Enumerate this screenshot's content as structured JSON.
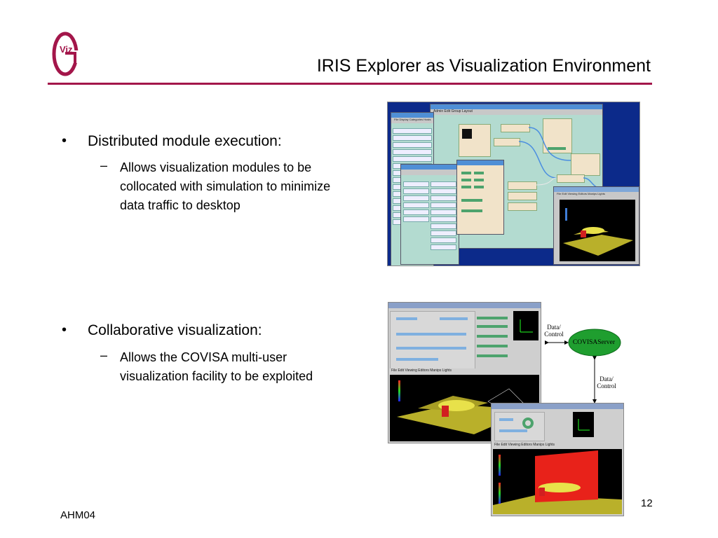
{
  "slide": {
    "title": "IRIS Explorer as Visualization Environment",
    "footer_left": "AHM04",
    "page_number": "12"
  },
  "logo": {
    "text": "Viz",
    "letter": "G",
    "color": "#a3164a"
  },
  "bullets": [
    {
      "marker": "•",
      "text": "Distributed module execution:",
      "sub": [
        {
          "marker": "–",
          "text": "Allows visualization modules to be collocated with simulation to minimize data traffic to desktop"
        }
      ]
    },
    {
      "marker": "•",
      "text": "Collaborative visualization:",
      "sub": [
        {
          "marker": "–",
          "text": "Allows the COVISA multi-user visualization facility to be exploited"
        }
      ]
    }
  ],
  "diagram": {
    "server_label": "COVISAServer",
    "upper_link_label": "Data/ Control",
    "lower_link_label": "Data/ Control",
    "server_color": "#1f9e2f"
  },
  "screenshot1": {
    "map_editor_title": "Map Editor on: cmpcu04.leeds.ac.uk",
    "map_editor_menu": "Admin   Edit   Group   Layout",
    "librarian_menu": "File   Display   Categories   Hosts",
    "render_menu": "File   Edit   Viewing   Editors   Manips   Lights"
  },
  "screenshot2": {
    "render_menu": "File   Edit   Viewing   Editors   Manips   Lights"
  },
  "screenshot3": {
    "render_menu": "File   Edit   Viewing   Editors   Manips   Lights"
  },
  "colors": {
    "accent": "#a3164a",
    "desktop_blue": "#0c2a8a",
    "module_box": "#f1e3c9",
    "terrain": "#b9b02a",
    "plume": "#e8e14a",
    "slice_red": "#e8221a"
  }
}
